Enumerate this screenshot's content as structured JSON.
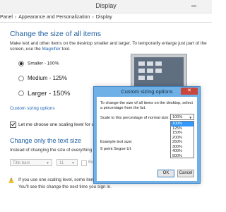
{
  "window": {
    "title": "Display",
    "breadcrumbs": [
      "Panel",
      "Appearance and Personalization",
      "Display"
    ]
  },
  "main": {
    "heading": "Change the size of all items",
    "description_before_link": "Make text and other items on the desktop smaller and larger. To temporarily enlarge just part of the screen, use the ",
    "magnifier_link": "Magnifier",
    "description_after_link": " tool.",
    "size_options": [
      {
        "label": "Smaller - 100%",
        "selected": true
      },
      {
        "label": "Medium - 125%",
        "selected": false
      },
      {
        "label": "Larger - 150%",
        "selected": false
      }
    ],
    "custom_sizing_link": "Custom sizing options",
    "scaling_checkbox_label": "Let me choose one scaling level for all my",
    "scaling_checkbox_checked": true,
    "text_size_heading": "Change only the text size",
    "text_size_description": "Instead of changing the size of everything on",
    "item_select_value": "Title bars",
    "font_size_value": "11",
    "bold_label": "Bold",
    "warning_line1": "If you use one scaling level, some items",
    "warning_line2": "You'll see this change the next time you sign in."
  },
  "dialog": {
    "title": "Custom sizing options",
    "close_label": "✕",
    "description": "To change the size of all items on the desktop, select a percentage from the list.",
    "scale_label": "Scale to this percentage of normal size:",
    "scale_value": "100%",
    "scale_options": [
      "100%",
      "125%",
      "150%",
      "200%",
      "250%",
      "300%",
      "400%",
      "500%"
    ],
    "selected_option_index": 0,
    "example_label": "Example text size:",
    "example_text": "9 point Segoe UI.",
    "ok_label": "OK",
    "cancel_label": "Cancel"
  },
  "colors": {
    "heading_blue": "#1e5f9f",
    "link_blue": "#1f64b4",
    "dialog_frame": "#6fb0e6",
    "selection": "#3399ff",
    "warning_yellow": "#f1c232"
  }
}
